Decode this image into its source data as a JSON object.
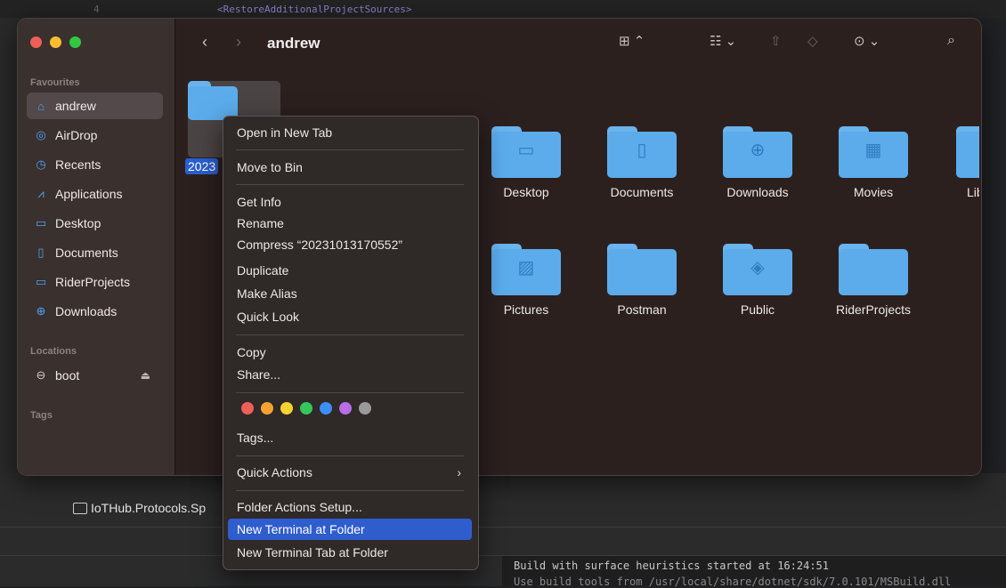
{
  "ide": {
    "code_line": "<RestoreAdditionalProjectSources>",
    "gutter_number": "4",
    "file_tab": "IoTHub.Protocols.Sp",
    "console_line1": "Build with surface heuristics started at 16:24:51",
    "console_line2": "Use build tools from /usr/local/share/dotnet/sdk/7.0.101/MSBuild.dll"
  },
  "finder": {
    "title": "andrew",
    "sidebar": {
      "favourites_label": "Favourites",
      "favourites": [
        {
          "label": "andrew",
          "icon": "home-icon"
        },
        {
          "label": "AirDrop",
          "icon": "airdrop-icon"
        },
        {
          "label": "Recents",
          "icon": "clock-icon"
        },
        {
          "label": "Applications",
          "icon": "applications-icon"
        },
        {
          "label": "Desktop",
          "icon": "desktop-icon"
        },
        {
          "label": "Documents",
          "icon": "document-icon"
        },
        {
          "label": "RiderProjects",
          "icon": "folder-icon"
        },
        {
          "label": "Downloads",
          "icon": "download-icon"
        }
      ],
      "locations_label": "Locations",
      "locations": [
        {
          "label": "boot",
          "icon": "drive-icon"
        }
      ],
      "tags_label": "Tags"
    },
    "selected_folder_label": "2023",
    "folders_row1": [
      {
        "label": "Desktop",
        "icon": "desktop-glyph"
      },
      {
        "label": "Documents",
        "icon": "document-glyph"
      },
      {
        "label": "Downloads",
        "icon": "download-glyph"
      },
      {
        "label": "Movies",
        "icon": "film-glyph"
      },
      {
        "label": "Lib",
        "icon": "library-glyph"
      }
    ],
    "folders_row2": [
      {
        "label": "Pictures",
        "icon": "picture-glyph"
      },
      {
        "label": "Postman",
        "icon": ""
      },
      {
        "label": "Public",
        "icon": "public-glyph"
      },
      {
        "label": "RiderProjects",
        "icon": ""
      }
    ]
  },
  "context_menu": {
    "open_new_tab": "Open in New Tab",
    "move_to_bin": "Move to Bin",
    "get_info": "Get Info",
    "rename": "Rename",
    "compress": "Compress “20231013170552”",
    "duplicate": "Duplicate",
    "make_alias": "Make Alias",
    "quick_look": "Quick Look",
    "copy": "Copy",
    "share": "Share...",
    "tags": "Tags...",
    "quick_actions": "Quick Actions",
    "folder_actions_setup": "Folder Actions Setup...",
    "new_terminal": "New Terminal at Folder",
    "new_terminal_tab": "New Terminal Tab at Folder",
    "tag_colors": [
      "#ee5f58",
      "#f6a233",
      "#f8d22f",
      "#35c759",
      "#3b8ff6",
      "#b76ee6",
      "#9a9a9a"
    ]
  }
}
